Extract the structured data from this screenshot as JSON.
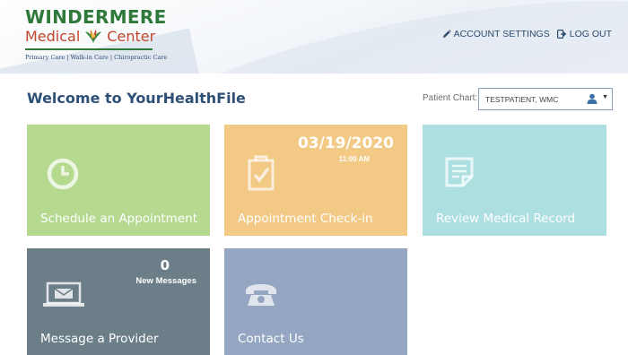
{
  "logo": {
    "line1": "WINDERMERE",
    "line2a": "Medical",
    "line2b": "Center",
    "tagline": "Primary Care | Walk-in Care | Chiropractic Care"
  },
  "header": {
    "account_settings": "ACCOUNT SETTINGS",
    "log_out": "LOG OUT"
  },
  "welcome": "Welcome to YourHealthFile",
  "patient_chart": {
    "label": "Patient Chart:",
    "value": "TESTPATIENT, WMC"
  },
  "tiles": {
    "schedule": {
      "label": "Schedule an Appointment",
      "icon": "clock-icon",
      "color": "#b5d98f"
    },
    "checkin": {
      "label": "Appointment Check-in",
      "date": "03/19/2020",
      "time": "11:00 AM",
      "icon": "clipboard-check-icon",
      "color": "#f2c985"
    },
    "record": {
      "label": "Review Medical Record",
      "icon": "document-icon",
      "color": "#addfe1"
    },
    "message": {
      "label": "Message a Provider",
      "count": "0",
      "count_label": "New Messages",
      "icon": "laptop-mail-icon",
      "color": "#6c7f89"
    },
    "contact": {
      "label": "Contact Us",
      "icon": "phone-icon",
      "color": "#94a6c2"
    }
  },
  "colors": {
    "brand_green": "#2f7a3a",
    "brand_red": "#c0462b",
    "heading_blue": "#2e5077"
  }
}
